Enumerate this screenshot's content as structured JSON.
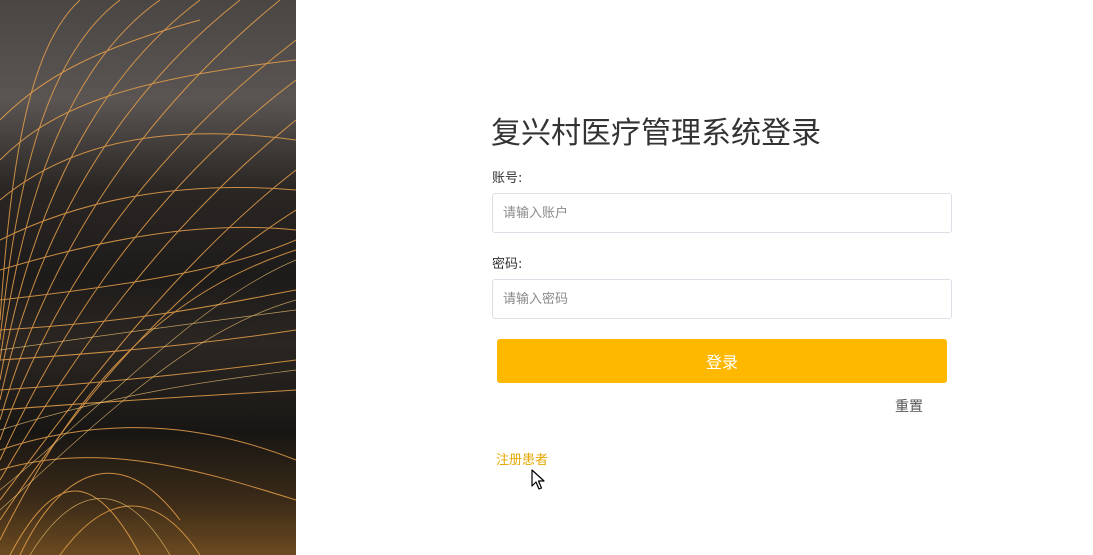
{
  "login": {
    "title": "复兴村医疗管理系统登录",
    "account_label": "账号:",
    "account_placeholder": "请输入账户",
    "password_label": "密码:",
    "password_placeholder": "请输入密码",
    "login_button": "登录",
    "reset_link": "重置",
    "register_link": "注册患者"
  },
  "colors": {
    "accent": "#ffb800",
    "link": "#e6a800"
  },
  "icons": {
    "cursor": "mouse-pointer-icon"
  }
}
